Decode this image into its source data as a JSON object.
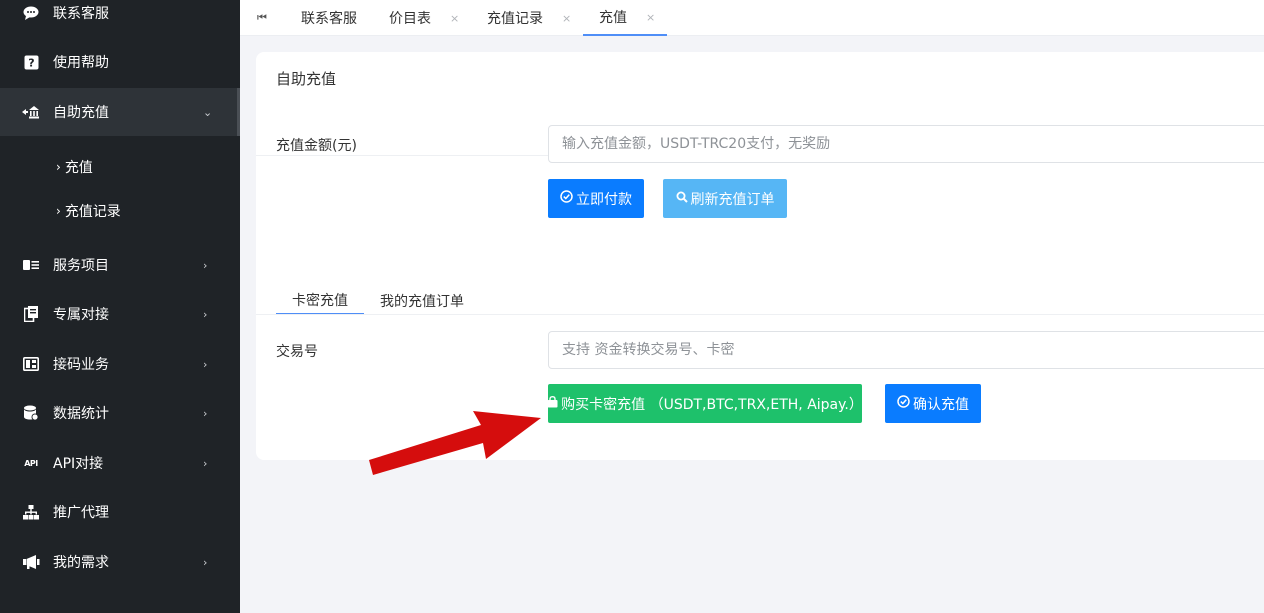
{
  "sidebar": {
    "items": [
      {
        "label": "联系客服",
        "icon": "chat-icon",
        "glyph": "💬"
      },
      {
        "label": "使用帮助",
        "icon": "help-icon",
        "glyph": "?"
      },
      {
        "label": "自助充值",
        "icon": "bank-icon",
        "glyph": "⇥"
      },
      {
        "label": "服务项目",
        "icon": "card-icon",
        "glyph": "▤"
      },
      {
        "label": "专属对接",
        "icon": "document-icon",
        "glyph": "▦"
      },
      {
        "label": "接码业务",
        "icon": "sms-icon",
        "glyph": "▣"
      },
      {
        "label": "数据统计",
        "icon": "database-icon",
        "glyph": "◉"
      },
      {
        "label": "API对接",
        "icon": "api-icon",
        "glyph": "API"
      },
      {
        "label": "推广代理",
        "icon": "sitemap-icon",
        "glyph": "⊞"
      },
      {
        "label": "我的需求",
        "icon": "megaphone-icon",
        "glyph": "◀"
      }
    ],
    "sub_items": [
      {
        "label": "充值",
        "arrow": "›"
      },
      {
        "label": "充值记录",
        "arrow": "›"
      }
    ]
  },
  "tabs": {
    "home_icon": "⏮",
    "items": [
      {
        "label": "联系客服",
        "close": ""
      },
      {
        "label": "价目表",
        "close": "×"
      },
      {
        "label": "充值记录",
        "close": "×"
      },
      {
        "label": "充值",
        "close": "×"
      }
    ]
  },
  "card": {
    "title": "自助充值",
    "amount_label": "充值金额(元)",
    "amount_placeholder": "输入充值金额，USDT-TRC20支付，无奖励",
    "pay_button": "立即付款",
    "refresh_button": "刷新充值订单",
    "subtabs": [
      "卡密充值",
      "我的充值订单"
    ],
    "txn_label": "交易号",
    "txn_placeholder": "支持 资金转换交易号、卡密",
    "buy_button": "购买卡密充值 （USDT,BTC,TRX,ETH, Aipay.）",
    "confirm_button": "确认充值"
  },
  "colors": {
    "sidebar_bg": "#1f2327",
    "primary": "#0a7cff",
    "refresh": "#56b6f5",
    "success": "#1ec16b",
    "arrow": "#d50d0d"
  }
}
